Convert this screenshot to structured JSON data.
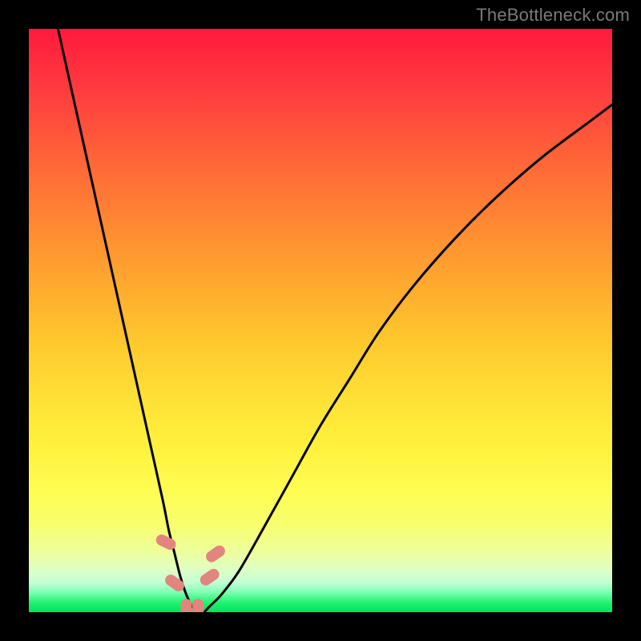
{
  "watermark": "TheBottleneck.com",
  "chart_data": {
    "type": "line",
    "title": "",
    "xlabel": "",
    "ylabel": "",
    "xlim": [
      0,
      100
    ],
    "ylim": [
      0,
      100
    ],
    "series": [
      {
        "name": "bottleneck-curve",
        "x": [
          5,
          7,
          9,
          11,
          13,
          15,
          17,
          19,
          21,
          23,
          24,
          25,
          26,
          27,
          28,
          29,
          30,
          31,
          33,
          36,
          40,
          45,
          50,
          55,
          60,
          66,
          73,
          80,
          88,
          96,
          100
        ],
        "values": [
          100,
          91,
          82,
          73,
          64,
          55,
          46,
          37,
          28,
          19,
          14,
          10,
          6,
          3,
          1,
          0,
          0,
          1,
          3,
          7,
          14,
          23,
          32,
          40,
          48,
          56,
          64,
          71,
          78,
          84,
          87
        ]
      }
    ],
    "markers": [
      {
        "x": 23.5,
        "y": 12,
        "rotation": -64
      },
      {
        "x": 25.0,
        "y": 5,
        "rotation": -55
      },
      {
        "x": 27.0,
        "y": 0.5,
        "rotation": 0
      },
      {
        "x": 29.0,
        "y": 0.5,
        "rotation": 0
      },
      {
        "x": 31.0,
        "y": 6,
        "rotation": 55
      },
      {
        "x": 32.0,
        "y": 10,
        "rotation": 55
      }
    ],
    "gradient_stops": [
      {
        "pos": 0,
        "color": "#ff1a3d"
      },
      {
        "pos": 0.5,
        "color": "#ffd933"
      },
      {
        "pos": 0.85,
        "color": "#fdff66"
      },
      {
        "pos": 1.0,
        "color": "#00e55a"
      }
    ]
  }
}
